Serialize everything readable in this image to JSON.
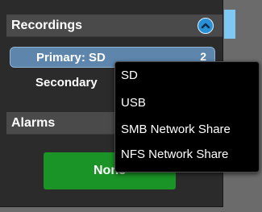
{
  "recordings": {
    "title": "Recordings",
    "items": [
      {
        "label": "Primary: SD",
        "count": "2"
      },
      {
        "label": "Secondary"
      }
    ]
  },
  "alarms": {
    "title": "Alarms",
    "button_label": "None"
  },
  "dropdown": {
    "options": [
      "SD",
      "USB",
      "SMB Network Share",
      "NFS Network Share"
    ]
  },
  "colors": {
    "accent": "#2a90d6",
    "selected_item": "#5e86ad",
    "none_button": "#1a9426"
  },
  "icons": {
    "collapse": "chevron-up-icon"
  }
}
